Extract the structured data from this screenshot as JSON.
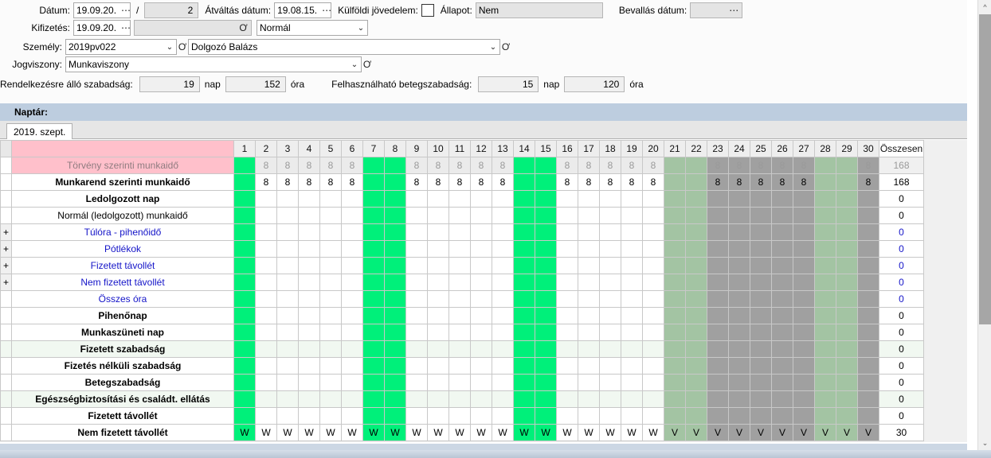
{
  "form": {
    "datum_label": "Dátum:",
    "datum_value": "19.09.20.",
    "slash": "/",
    "period_value": "2",
    "atvaltas_label": "Átváltás dátum:",
    "atvaltas_value": "19.08.15.",
    "kulfoldi_label": "Külföldi jövedelem:",
    "allapot_label": "Állapot:",
    "allapot_value": "Nem",
    "bevallas_label": "Bevallás dátum:",
    "bevallas_value": "",
    "kifizetes_label": "Kifizetés:",
    "kifizetes_value": "19.09.20.",
    "kifizetes_extra_value": "",
    "tipus_value": "Normál",
    "szemely_label": "Személy:",
    "szemely_code": "2019pv022",
    "szemely_name": "Dolgozó Balázs",
    "jogviszony_label": "Jogviszony:",
    "jogviszony_value": "Munkaviszony",
    "szabadsag_label": "Rendelkezésre álló szabadság:",
    "szabadsag_nap": "19",
    "nap_unit": "nap",
    "szabadsag_ora": "152",
    "ora_unit": "óra",
    "betegszabadsag_label": "Felhasználható betegszabadság:",
    "betegszabadsag_nap": "15",
    "betegszabadsag_ora": "120",
    "dots_glyph": "⋯",
    "caret_glyph": "⌄",
    "clip_glyph": "Ơ"
  },
  "calendar": {
    "section_label": "Naptár:",
    "tab_label": "2019. szept."
  },
  "grid": {
    "day_headers": [
      "1",
      "2",
      "3",
      "4",
      "5",
      "6",
      "7",
      "8",
      "9",
      "10",
      "11",
      "12",
      "13",
      "14",
      "15",
      "16",
      "17",
      "18",
      "19",
      "20",
      "21",
      "22",
      "23",
      "24",
      "25",
      "26",
      "27",
      "28",
      "29",
      "30"
    ],
    "total_header": "Összesen",
    "weekend_days": [
      1,
      7,
      8,
      14,
      15,
      21,
      22,
      28,
      29
    ],
    "locked_from_day": 21,
    "rows": [
      {
        "label": "Törvény szerinti munkaidő",
        "expand": "",
        "style": "pink",
        "cells": [
          "",
          "8",
          "8",
          "8",
          "8",
          "8",
          "",
          "",
          "8",
          "8",
          "8",
          "8",
          "8",
          "",
          "",
          "8",
          "8",
          "8",
          "8",
          "8",
          "",
          "",
          "8",
          "8",
          "8",
          "8",
          "8",
          "",
          "",
          "8"
        ],
        "total": "168",
        "total_style": "gray"
      },
      {
        "label": "Munkarend szerinti munkaidő",
        "expand": "",
        "style": "bold",
        "cells": [
          "",
          "8",
          "8",
          "8",
          "8",
          "8",
          "",
          "",
          "8",
          "8",
          "8",
          "8",
          "8",
          "",
          "",
          "8",
          "8",
          "8",
          "8",
          "8",
          "",
          "",
          "8",
          "8",
          "8",
          "8",
          "8",
          "",
          "",
          "8"
        ],
        "total": "168",
        "total_style": "bold"
      },
      {
        "label": "Ledolgozott nap",
        "expand": "",
        "style": "bold",
        "cells": [
          "",
          "",
          "",
          "",
          "",
          "",
          "",
          "",
          "",
          "",
          "",
          "",
          "",
          "",
          "",
          "",
          "",
          "",
          "",
          "",
          "",
          "",
          "",
          "",
          "",
          "",
          "",
          "",
          "",
          ""
        ],
        "total": "0",
        "total_style": "bold"
      },
      {
        "label": "Normál (ledolgozott) munkaidő",
        "expand": "",
        "style": "plain",
        "cells": [
          "",
          "",
          "",
          "",
          "",
          "",
          "",
          "",
          "",
          "",
          "",
          "",
          "",
          "",
          "",
          "",
          "",
          "",
          "",
          "",
          "",
          "",
          "",
          "",
          "",
          "",
          "",
          "",
          "",
          ""
        ],
        "total": "0",
        "total_style": "normal"
      },
      {
        "label": "Túlóra - pihenőidő",
        "expand": "+",
        "style": "link",
        "cells": [
          "",
          "",
          "",
          "",
          "",
          "",
          "",
          "",
          "",
          "",
          "",
          "",
          "",
          "",
          "",
          "",
          "",
          "",
          "",
          "",
          "",
          "",
          "",
          "",
          "",
          "",
          "",
          "",
          "",
          ""
        ],
        "total": "0",
        "total_style": "link"
      },
      {
        "label": "Pótlékok",
        "expand": "+",
        "style": "link",
        "cells": [
          "",
          "",
          "",
          "",
          "",
          "",
          "",
          "",
          "",
          "",
          "",
          "",
          "",
          "",
          "",
          "",
          "",
          "",
          "",
          "",
          "",
          "",
          "",
          "",
          "",
          "",
          "",
          "",
          "",
          ""
        ],
        "total": "0",
        "total_style": "link"
      },
      {
        "label": "Fizetett távollét",
        "expand": "+",
        "style": "link",
        "cells": [
          "",
          "",
          "",
          "",
          "",
          "",
          "",
          "",
          "",
          "",
          "",
          "",
          "",
          "",
          "",
          "",
          "",
          "",
          "",
          "",
          "",
          "",
          "",
          "",
          "",
          "",
          "",
          "",
          "",
          ""
        ],
        "total": "0",
        "total_style": "link"
      },
      {
        "label": "Nem fizetett távollét",
        "expand": "+",
        "style": "link",
        "cells": [
          "",
          "",
          "",
          "",
          "",
          "",
          "",
          "",
          "",
          "",
          "",
          "",
          "",
          "",
          "",
          "",
          "",
          "",
          "",
          "",
          "",
          "",
          "",
          "",
          "",
          "",
          "",
          "",
          "",
          ""
        ],
        "total": "0",
        "total_style": "link"
      },
      {
        "label": "Összes óra",
        "expand": "",
        "style": "link",
        "cells": [
          "",
          "",
          "",
          "",
          "",
          "",
          "",
          "",
          "",
          "",
          "",
          "",
          "",
          "",
          "",
          "",
          "",
          "",
          "",
          "",
          "",
          "",
          "",
          "",
          "",
          "",
          "",
          "",
          "",
          ""
        ],
        "total": "0",
        "total_style": "link"
      },
      {
        "label": "Pihenőnap",
        "expand": "",
        "style": "bold",
        "cells": [
          "",
          "",
          "",
          "",
          "",
          "",
          "",
          "",
          "",
          "",
          "",
          "",
          "",
          "",
          "",
          "",
          "",
          "",
          "",
          "",
          "",
          "",
          "",
          "",
          "",
          "",
          "",
          "",
          "",
          ""
        ],
        "total": "0",
        "total_style": "bold"
      },
      {
        "label": "Munkaszüneti nap",
        "expand": "",
        "style": "bold",
        "cells": [
          "",
          "",
          "",
          "",
          "",
          "",
          "",
          "",
          "",
          "",
          "",
          "",
          "",
          "",
          "",
          "",
          "",
          "",
          "",
          "",
          "",
          "",
          "",
          "",
          "",
          "",
          "",
          "",
          "",
          ""
        ],
        "total": "0",
        "total_style": "bold"
      },
      {
        "label": "Fizetett szabadság",
        "expand": "",
        "style": "bold",
        "tint": true,
        "cells": [
          "",
          "",
          "",
          "",
          "",
          "",
          "",
          "",
          "",
          "",
          "",
          "",
          "",
          "",
          "",
          "",
          "",
          "",
          "",
          "",
          "",
          "",
          "",
          "",
          "",
          "",
          "",
          "",
          "",
          ""
        ],
        "total": "0",
        "total_style": "bold"
      },
      {
        "label": "Fizetés nélküli szabadság",
        "expand": "",
        "style": "bold",
        "cells": [
          "",
          "",
          "",
          "",
          "",
          "",
          "",
          "",
          "",
          "",
          "",
          "",
          "",
          "",
          "",
          "",
          "",
          "",
          "",
          "",
          "",
          "",
          "",
          "",
          "",
          "",
          "",
          "",
          "",
          ""
        ],
        "total": "0",
        "total_style": "bold"
      },
      {
        "label": "Betegszabadság",
        "expand": "",
        "style": "bold",
        "cells": [
          "",
          "",
          "",
          "",
          "",
          "",
          "",
          "",
          "",
          "",
          "",
          "",
          "",
          "",
          "",
          "",
          "",
          "",
          "",
          "",
          "",
          "",
          "",
          "",
          "",
          "",
          "",
          "",
          "",
          ""
        ],
        "total": "0",
        "total_style": "bold"
      },
      {
        "label": "Egészségbiztosítási és családt. ellátás",
        "expand": "",
        "style": "bold",
        "tint": true,
        "cells": [
          "",
          "",
          "",
          "",
          "",
          "",
          "",
          "",
          "",
          "",
          "",
          "",
          "",
          "",
          "",
          "",
          "",
          "",
          "",
          "",
          "",
          "",
          "",
          "",
          "",
          "",
          "",
          "",
          "",
          ""
        ],
        "total": "0",
        "total_style": "bold"
      },
      {
        "label": "Fizetett távollét",
        "expand": "",
        "style": "bold",
        "cells": [
          "",
          "",
          "",
          "",
          "",
          "",
          "",
          "",
          "",
          "",
          "",
          "",
          "",
          "",
          "",
          "",
          "",
          "",
          "",
          "",
          "",
          "",
          "",
          "",
          "",
          "",
          "",
          "",
          "",
          ""
        ],
        "total": "0",
        "total_style": "bold"
      },
      {
        "label": "Nem fizetett távollét",
        "expand": "",
        "style": "bold",
        "cells": [
          "W",
          "W",
          "W",
          "W",
          "W",
          "W",
          "W",
          "W",
          "W",
          "W",
          "W",
          "W",
          "W",
          "W",
          "W",
          "W",
          "W",
          "W",
          "W",
          "W",
          "V",
          "V",
          "V",
          "V",
          "V",
          "V",
          "V",
          "V",
          "V",
          "V"
        ],
        "total": "30",
        "total_style": "bold"
      }
    ]
  },
  "colors": {
    "accent_bar": "#bdcddf",
    "green_cell": "#00f07a",
    "pink_row": "#ffc0cb",
    "locked_gray": "#a0a0a0",
    "locked_weekend": "#a3c4a3",
    "link_text": "#1414c8"
  }
}
